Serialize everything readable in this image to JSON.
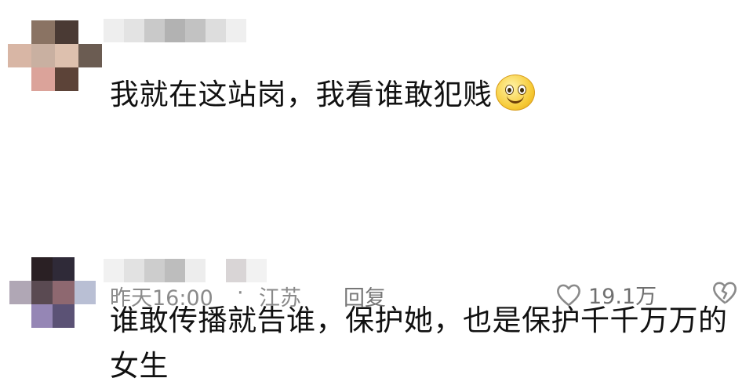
{
  "comments": [
    {
      "avatar_colors": [
        "#ffffff",
        "#8a7363",
        "#4a3a34",
        "#ffffff",
        "#d8b6a5",
        "#c9b0a1",
        "#ddc0ae",
        "#6b5c52",
        "#ffffff",
        "#dba39a",
        "#5c4338",
        "#ffffff"
      ],
      "name_blur_colors": [
        "#eeeeee",
        "#e3e3e3",
        "#c9c9c9",
        "#b2b2b2",
        "#c2c2c2",
        "#dddddd",
        "#efefef"
      ],
      "text": "我就在这站岗，我看谁敢犯贱",
      "emoji": "smile-emoji"
    },
    {
      "avatar_colors": [
        "#ffffff",
        "#2a2024",
        "#2f2a38",
        "#ffffff",
        "#b0a7b5",
        "#5a4a52",
        "#8e6870",
        "#b9bfd4",
        "#ffffff",
        "#9586b5",
        "#5b5275",
        "#ffffff"
      ],
      "name_blur_colors": [
        "#f1f1f1",
        "#e2e2e2",
        "#cdcdcd",
        "#bdbdbd",
        "#ededed",
        "#ffffff",
        "#d9d5d6",
        "#f2f2f2"
      ],
      "text": "谁敢传播就告谁，保护她，也是保护千千万万的女生",
      "meta": {
        "time": "昨天16:00",
        "dot": "·",
        "location": "江苏",
        "reply_label": "回复",
        "like_count": "19.1万"
      }
    }
  ]
}
